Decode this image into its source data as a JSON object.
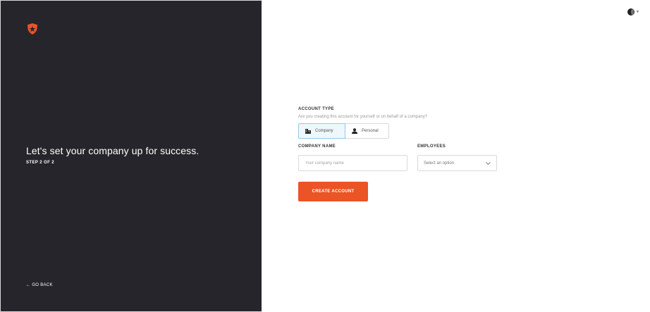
{
  "left_panel": {
    "headline": "Let's set your company up for success.",
    "step": "STEP 2 OF 2",
    "go_back": "GO BACK",
    "background_color": "#26252b",
    "logo_color": "#eb5424",
    "logo_icon": "shield-star-icon"
  },
  "header": {
    "avatar_icon": "user-avatar-icon",
    "avatar_menu_icon": "chevron-down-icon"
  },
  "form": {
    "account_type": {
      "label": "ACCOUNT TYPE",
      "help": "Are you creating this account for yourself or on behalf of a company?",
      "options": [
        {
          "label": "Company",
          "icon": "building-icon",
          "selected": true
        },
        {
          "label": "Personal",
          "icon": "person-icon",
          "selected": false
        }
      ]
    },
    "company_name": {
      "label": "COMPANY NAME",
      "placeholder": "Your company name",
      "value": ""
    },
    "employees": {
      "label": "EMPLOYEES",
      "placeholder": "Select an option",
      "icon": "chevron-down-icon"
    },
    "submit_label": "CREATE ACCOUNT",
    "accent_color": "#eb5424"
  }
}
